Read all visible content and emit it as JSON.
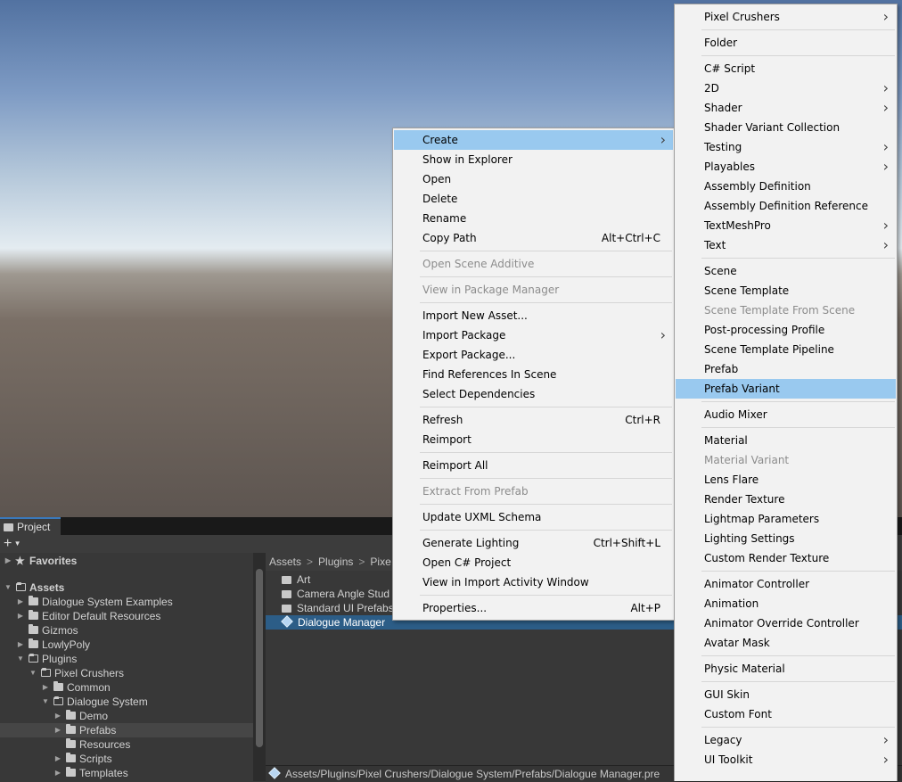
{
  "project": {
    "tab_label": "Project",
    "add_label": "+",
    "tree": [
      {
        "label": "Favorites",
        "head": true
      },
      {
        "label": "Assets",
        "head": true
      },
      {
        "label": "Dialogue System Examples"
      },
      {
        "label": "Editor Default Resources"
      },
      {
        "label": "Gizmos"
      },
      {
        "label": "LowlyPoly"
      },
      {
        "label": "Plugins"
      },
      {
        "label": "Pixel Crushers"
      },
      {
        "label": "Common"
      },
      {
        "label": "Dialogue System"
      },
      {
        "label": "Demo"
      },
      {
        "label": "Prefabs"
      },
      {
        "label": "Resources"
      },
      {
        "label": "Scripts"
      },
      {
        "label": "Templates"
      }
    ],
    "breadcrumb": [
      "Assets",
      "Plugins",
      "Pixe"
    ],
    "breadcrumb_sep": ">",
    "asset_items": [
      "Art",
      "Camera Angle Stud",
      "Standard UI Prefabs",
      "Dialogue Manager"
    ],
    "path": "Assets/Plugins/Pixel Crushers/Dialogue System/Prefabs/Dialogue Manager.pre"
  },
  "menu1": {
    "items": [
      {
        "label": "Create",
        "submenu": true,
        "highlight": true
      },
      {
        "label": "Show in Explorer"
      },
      {
        "label": "Open"
      },
      {
        "label": "Delete"
      },
      {
        "label": "Rename"
      },
      {
        "label": "Copy Path",
        "shortcut": "Alt+Ctrl+C"
      },
      {
        "sep": true
      },
      {
        "label": "Open Scene Additive",
        "disabled": true
      },
      {
        "sep": true
      },
      {
        "label": "View in Package Manager",
        "disabled": true
      },
      {
        "sep": true
      },
      {
        "label": "Import New Asset..."
      },
      {
        "label": "Import Package",
        "submenu": true
      },
      {
        "label": "Export Package..."
      },
      {
        "label": "Find References In Scene"
      },
      {
        "label": "Select Dependencies"
      },
      {
        "sep": true
      },
      {
        "label": "Refresh",
        "shortcut": "Ctrl+R"
      },
      {
        "label": "Reimport"
      },
      {
        "sep": true
      },
      {
        "label": "Reimport All"
      },
      {
        "sep": true
      },
      {
        "label": "Extract From Prefab",
        "disabled": true
      },
      {
        "sep": true
      },
      {
        "label": "Update UXML Schema"
      },
      {
        "sep": true
      },
      {
        "label": "Generate Lighting",
        "shortcut": "Ctrl+Shift+L"
      },
      {
        "label": "Open C# Project"
      },
      {
        "label": "View in Import Activity Window"
      },
      {
        "sep": true
      },
      {
        "label": "Properties...",
        "shortcut": "Alt+P"
      }
    ]
  },
  "menu2": {
    "items": [
      {
        "label": "Pixel Crushers",
        "submenu": true
      },
      {
        "sep": true
      },
      {
        "label": "Folder"
      },
      {
        "sep": true
      },
      {
        "label": "C# Script"
      },
      {
        "label": "2D",
        "submenu": true
      },
      {
        "label": "Shader",
        "submenu": true
      },
      {
        "label": "Shader Variant Collection"
      },
      {
        "label": "Testing",
        "submenu": true
      },
      {
        "label": "Playables",
        "submenu": true
      },
      {
        "label": "Assembly Definition"
      },
      {
        "label": "Assembly Definition Reference"
      },
      {
        "label": "TextMeshPro",
        "submenu": true
      },
      {
        "label": "Text",
        "submenu": true
      },
      {
        "sep": true
      },
      {
        "label": "Scene"
      },
      {
        "label": "Scene Template"
      },
      {
        "label": "Scene Template From Scene",
        "disabled": true
      },
      {
        "label": "Post-processing Profile"
      },
      {
        "label": "Scene Template Pipeline"
      },
      {
        "label": "Prefab"
      },
      {
        "label": "Prefab Variant",
        "highlight": true
      },
      {
        "sep": true
      },
      {
        "label": "Audio Mixer"
      },
      {
        "sep": true
      },
      {
        "label": "Material"
      },
      {
        "label": "Material Variant",
        "disabled": true
      },
      {
        "label": "Lens Flare"
      },
      {
        "label": "Render Texture"
      },
      {
        "label": "Lightmap Parameters"
      },
      {
        "label": "Lighting Settings"
      },
      {
        "label": "Custom Render Texture"
      },
      {
        "sep": true
      },
      {
        "label": "Animator Controller"
      },
      {
        "label": "Animation"
      },
      {
        "label": "Animator Override Controller"
      },
      {
        "label": "Avatar Mask"
      },
      {
        "sep": true
      },
      {
        "label": "Physic Material"
      },
      {
        "sep": true
      },
      {
        "label": "GUI Skin"
      },
      {
        "label": "Custom Font"
      },
      {
        "sep": true
      },
      {
        "label": "Legacy",
        "submenu": true
      },
      {
        "label": "UI Toolkit",
        "submenu": true
      }
    ]
  },
  "colors": {
    "highlight": "#99c9ef",
    "selection": "#2c5d87",
    "menu_bg": "#f2f2f2",
    "panel_bg": "#383838"
  },
  "icons": {
    "submenu": "chevron-right-icon",
    "folder": "folder-icon",
    "prefab": "prefab-cube-icon",
    "star": "star-icon"
  }
}
